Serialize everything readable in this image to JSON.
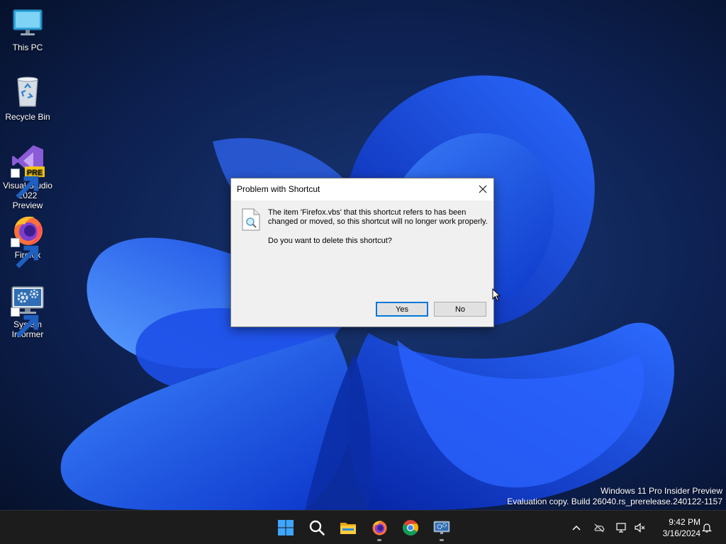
{
  "desktop": {
    "icons": [
      {
        "label": "This PC",
        "icon": "monitor-icon"
      },
      {
        "label": "Recycle Bin",
        "icon": "recycle-bin-icon"
      },
      {
        "label": "Visual Studio 2022 Preview",
        "icon": "visual-studio-icon",
        "badge": "PRE"
      },
      {
        "label": "Firefox",
        "icon": "firefox-icon"
      },
      {
        "label": "System Informer",
        "icon": "system-informer-icon"
      }
    ],
    "watermark": {
      "line1": "Windows 11 Pro Insider Preview",
      "line2": "Evaluation copy. Build 26040.rs_prerelease.240122-1157"
    }
  },
  "dialog": {
    "title": "Problem with Shortcut",
    "message": "The item 'Firefox.vbs' that this shortcut refers to has been changed or moved, so this shortcut will no longer work properly.",
    "question": "Do you want to delete this shortcut?",
    "yes_label": "Yes",
    "no_label": "No",
    "default_button": "Yes"
  },
  "taskbar": {
    "pinned": [
      {
        "name": "start-button",
        "icon": "windows-logo-icon"
      },
      {
        "name": "search-button",
        "icon": "search-icon"
      },
      {
        "name": "file-explorer-button",
        "icon": "folder-icon"
      },
      {
        "name": "firefox-button",
        "icon": "firefox-icon",
        "running": true
      },
      {
        "name": "chrome-button",
        "icon": "chrome-icon"
      },
      {
        "name": "system-informer-button",
        "icon": "system-informer-icon",
        "running": true
      }
    ],
    "tray": {
      "icons": [
        "chevron-up-icon",
        "onedrive-icon",
        "network-icon",
        "volume-muted-icon",
        "notification-bell-icon"
      ],
      "time": "9:42 PM",
      "date": "3/16/2024"
    }
  },
  "colors": {
    "accent": "#0078d7",
    "taskbar": "#1c1c1c",
    "dialog_bg": "#f0f0f0"
  }
}
